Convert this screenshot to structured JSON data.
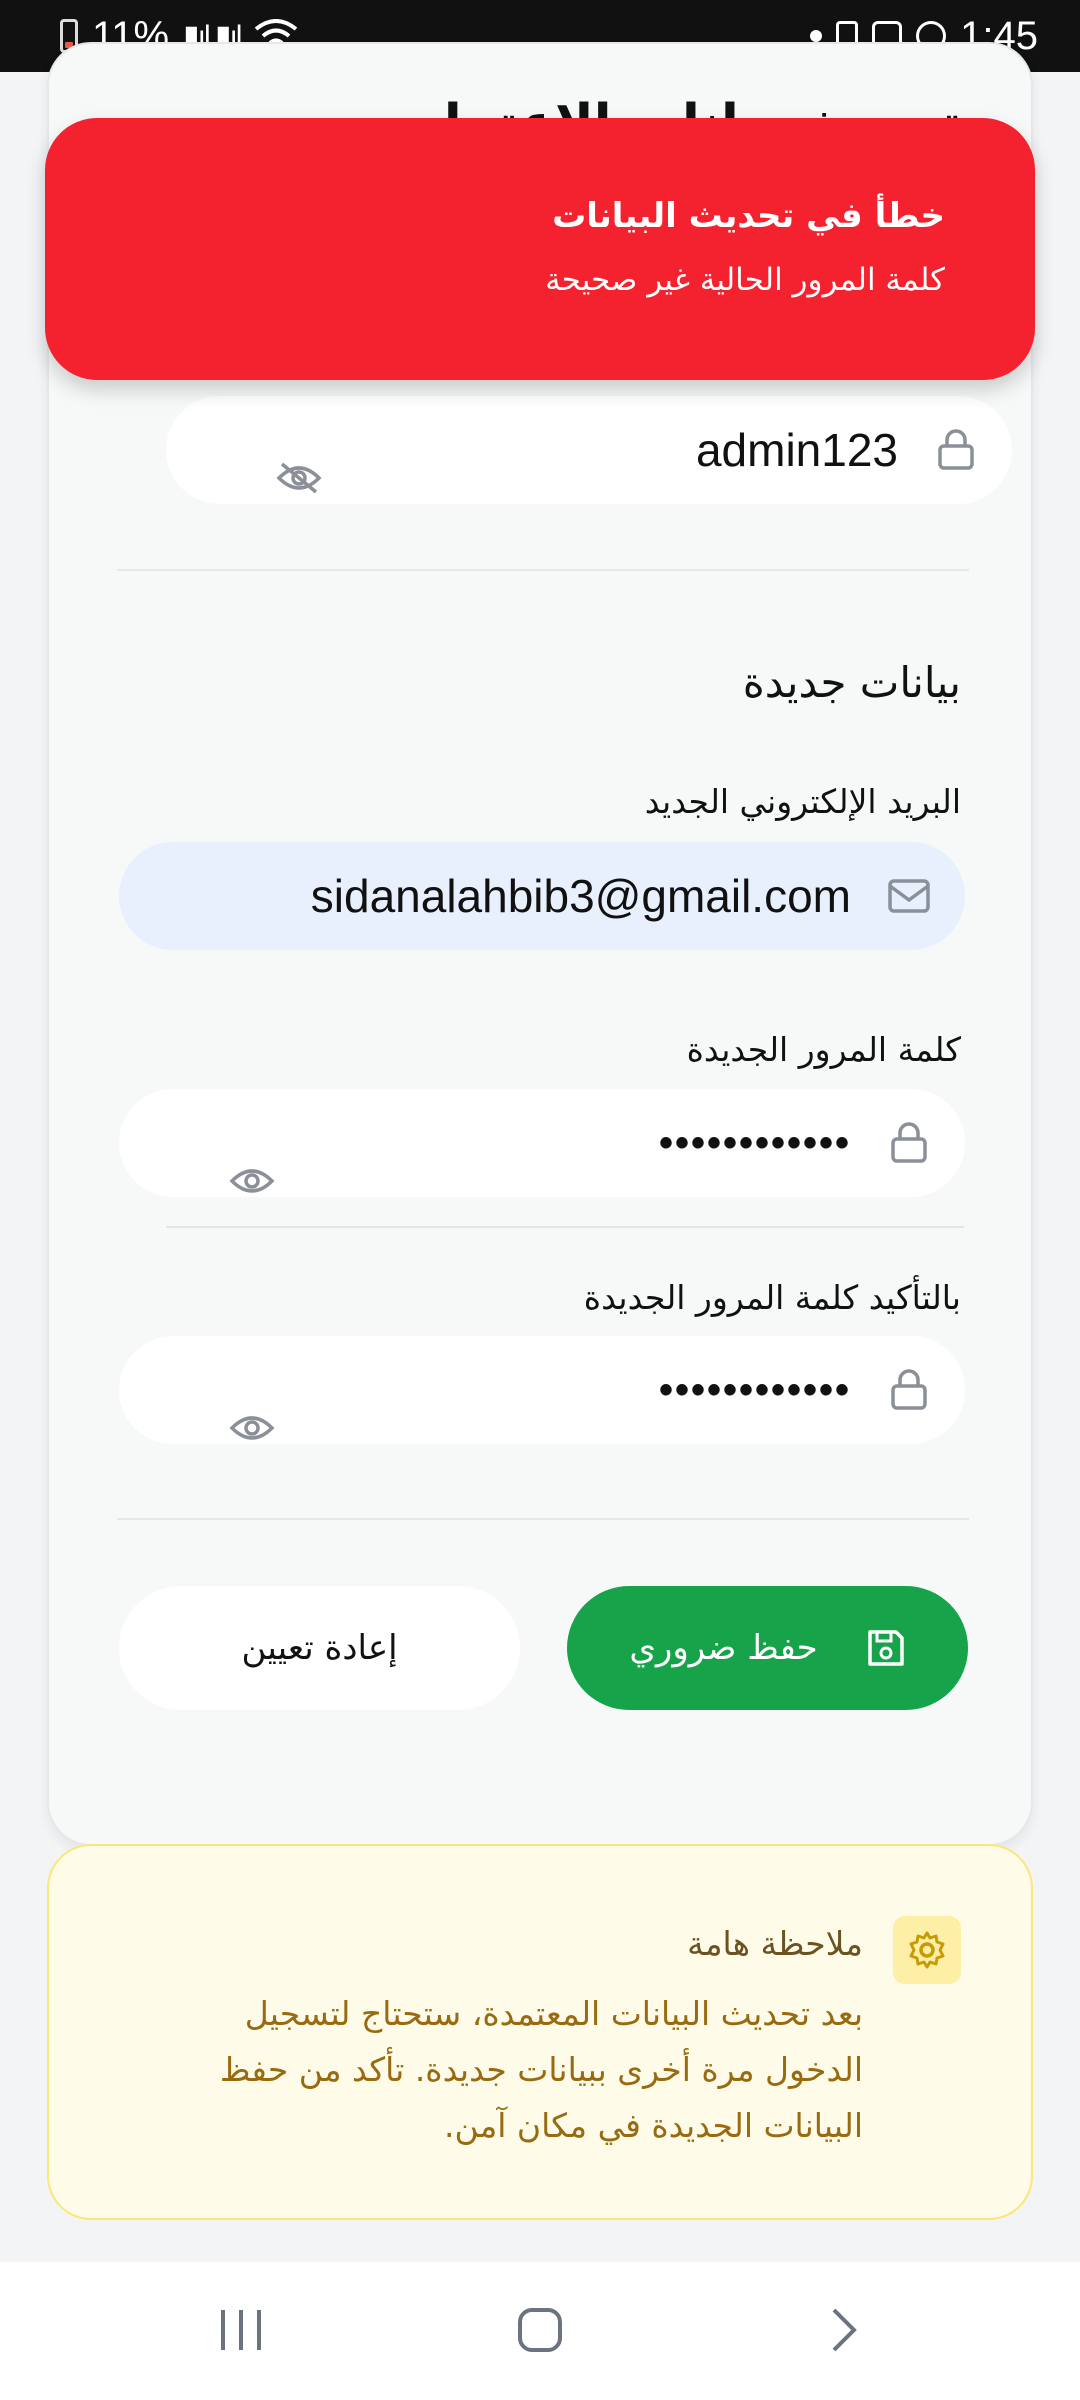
{
  "status_bar": {
    "battery": "11%",
    "time": "1:45"
  },
  "card": {
    "title": "تحديث بيانات الاعتماد"
  },
  "toast": {
    "title": "خطأ في تحديث البيانات",
    "message": "كلمة المرور الحالية غير صحيحة"
  },
  "current_password": {
    "value": "admin123"
  },
  "new_section": {
    "title": "بيانات جديدة",
    "email_label": "البريد الإلكتروني الجديد",
    "email_value": "sidanalahbib3@gmail.com",
    "password_label": "كلمة المرور الجديدة",
    "password_value": "••••••••••••",
    "confirm_label": "بالتأكيد كلمة المرور الجديدة",
    "confirm_value": "••••••••••••"
  },
  "buttons": {
    "save": "حفظ ضروري",
    "reset": "إعادة تعيين"
  },
  "note": {
    "title": "ملاحظة هامة",
    "body": "بعد تحديث البيانات المعتمدة، ستحتاج لتسجيل الدخول مرة أخرى ببيانات جديدة. تأكد من حفظ البيانات الجديدة في مكان آمن."
  },
  "colors": {
    "toast_bg": "#f4212f",
    "save_bg": "#16a34a",
    "note_bg": "#fefbe8",
    "email_field_bg": "#e8f0fe"
  },
  "icons": [
    "lock-icon",
    "eye-off-icon",
    "eye-icon",
    "mail-icon",
    "save-icon",
    "gear-icon"
  ]
}
